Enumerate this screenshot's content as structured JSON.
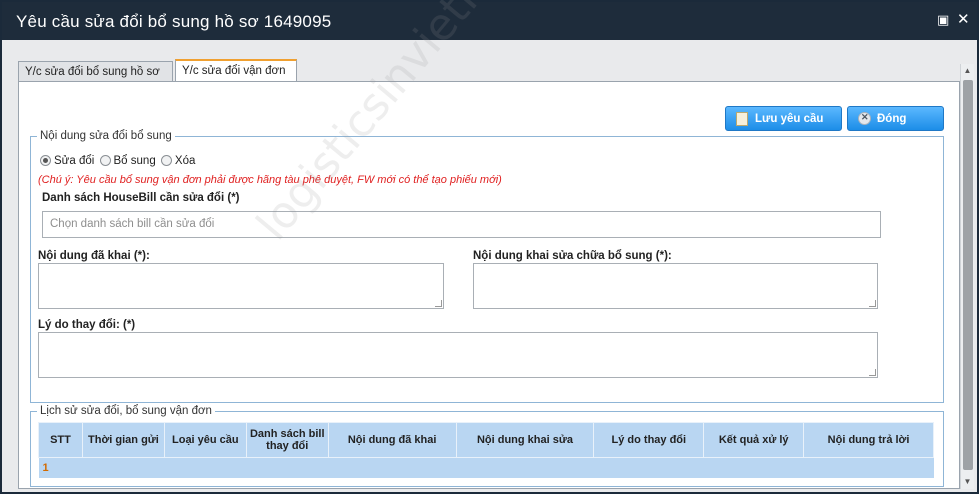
{
  "window": {
    "title": "Yêu cầu sửa đổi bổ sung hồ sơ 1649095",
    "maximize_icon": "maximize-icon",
    "close_icon": "close-icon"
  },
  "tabs": [
    {
      "label": "Y/c sửa đổi bổ sung hồ sơ",
      "active": false
    },
    {
      "label": "Y/c sửa đổi vận đơn",
      "active": true
    }
  ],
  "toolbar": {
    "save_label": "Lưu yêu cầu",
    "close_label": "Đóng"
  },
  "edit_group": {
    "legend": "Nội dung sửa đổi bổ sung",
    "radios": [
      {
        "label": "Sửa đổi",
        "checked": true
      },
      {
        "label": "Bổ sung",
        "checked": false
      },
      {
        "label": "Xóa",
        "checked": false
      }
    ],
    "note": "(Chú ý: Yêu cầu bổ sung vận đơn phải được hãng tàu phê duyệt, FW mới có thể tạo phiếu mới)",
    "housebill_label": "Danh sách HouseBill cần sửa đổi",
    "required_mark": "(*)",
    "housebill_placeholder": "Chọn danh sách bill cần sửa đổi",
    "declared_label": "Nội dung đã khai",
    "declared_req": "(*):",
    "amend_label": "Nội dung khai sửa chữa bổ sung",
    "amend_req": "(*):",
    "reason_label": "Lý do thay đổi:",
    "reason_req": "(*)"
  },
  "history_group": {
    "legend": "Lịch sử sửa đổi, bổ sung vận đơn",
    "columns": [
      "STT",
      "Thời gian gửi",
      "Loại yêu cầu",
      "Danh sách bill thay đổi",
      "Nội dung đã khai",
      "Nội dung khai sửa",
      "Lý do thay đổi",
      "Kết quả xử lý",
      "Nội dung trả lời"
    ],
    "rows": [
      [
        "1",
        "",
        "",
        "",
        "",
        "",
        "",
        "",
        ""
      ]
    ]
  },
  "watermark": "logisticsinvietnam.vn",
  "colors": {
    "titlebar": "#1e2c3b",
    "button": "#1c8de8",
    "note": "#e02020",
    "table_header": "#b9d6f2",
    "row_number": "#d26a00"
  }
}
